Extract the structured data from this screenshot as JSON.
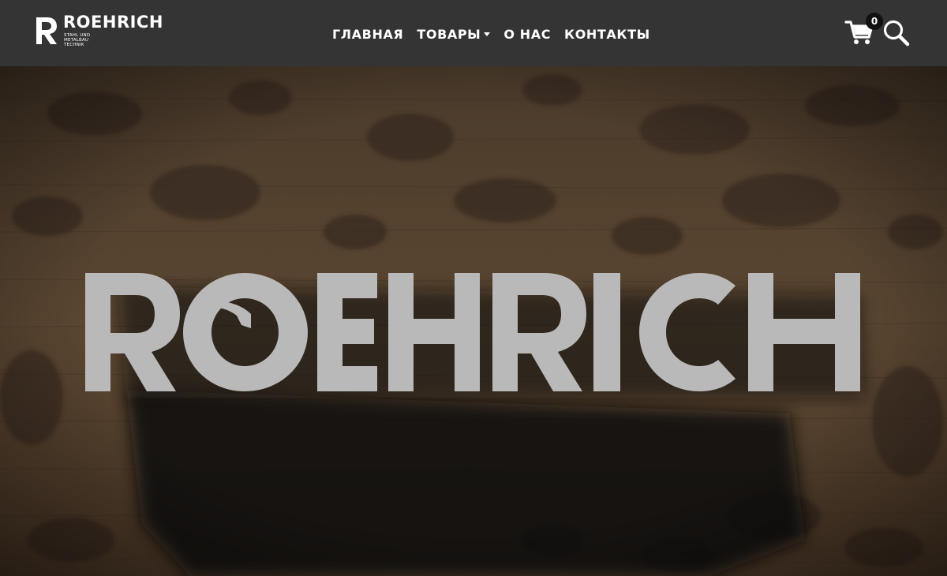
{
  "brand": {
    "name": "ROEHRICH",
    "tagline": "STAHL UND METALBAU TECHNIK"
  },
  "nav": {
    "items": [
      {
        "label": "ГЛАВНАЯ",
        "dropdown": false
      },
      {
        "label": "ТОВАРЫ",
        "dropdown": true
      },
      {
        "label": "О НАС",
        "dropdown": false
      },
      {
        "label": "КОНТАКТЫ",
        "dropdown": false
      }
    ]
  },
  "cart": {
    "count": "0",
    "icon": "cart-icon"
  },
  "search": {
    "icon": "search-icon"
  },
  "hero": {
    "logo_text": "ROEHRICH",
    "colors": {
      "wood": "#4a3a2b",
      "logo": "#b9b9b9",
      "nav_bg": "#343434"
    }
  }
}
